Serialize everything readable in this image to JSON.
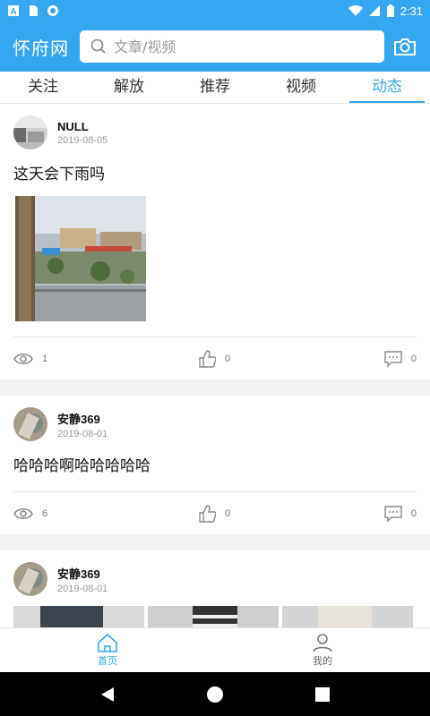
{
  "status_bar": {
    "time": "2:31",
    "icons": [
      "a-icon",
      "sim-card-icon",
      "circle-icon",
      "wifi-icon",
      "signal-icon",
      "battery-icon"
    ]
  },
  "header": {
    "title": "怀府网",
    "search_placeholder": "文章/视频",
    "camera_icon": "camera-icon"
  },
  "tabs": [
    {
      "label": "关注",
      "active": false
    },
    {
      "label": "解放",
      "active": false
    },
    {
      "label": "推荐",
      "active": false
    },
    {
      "label": "视频",
      "active": false
    },
    {
      "label": "动态",
      "active": true
    }
  ],
  "posts": [
    {
      "user": "NULL",
      "date": "2019-08-05",
      "text": "这天会下雨吗",
      "views": "1",
      "likes": "0",
      "comments": "0"
    },
    {
      "user": "安静369",
      "date": "2019-08-01",
      "text": "哈哈哈啊哈哈哈哈哈",
      "views": "6",
      "likes": "0",
      "comments": "0"
    },
    {
      "user": "安静369",
      "date": "2019-08-01"
    }
  ],
  "bottom_nav": [
    {
      "label": "首页",
      "icon": "home-icon",
      "active": true
    },
    {
      "label": "我的",
      "icon": "user-icon",
      "active": false
    }
  ],
  "colors": {
    "accent": "#35a6f0",
    "text": "#111111",
    "muted": "#999999"
  }
}
